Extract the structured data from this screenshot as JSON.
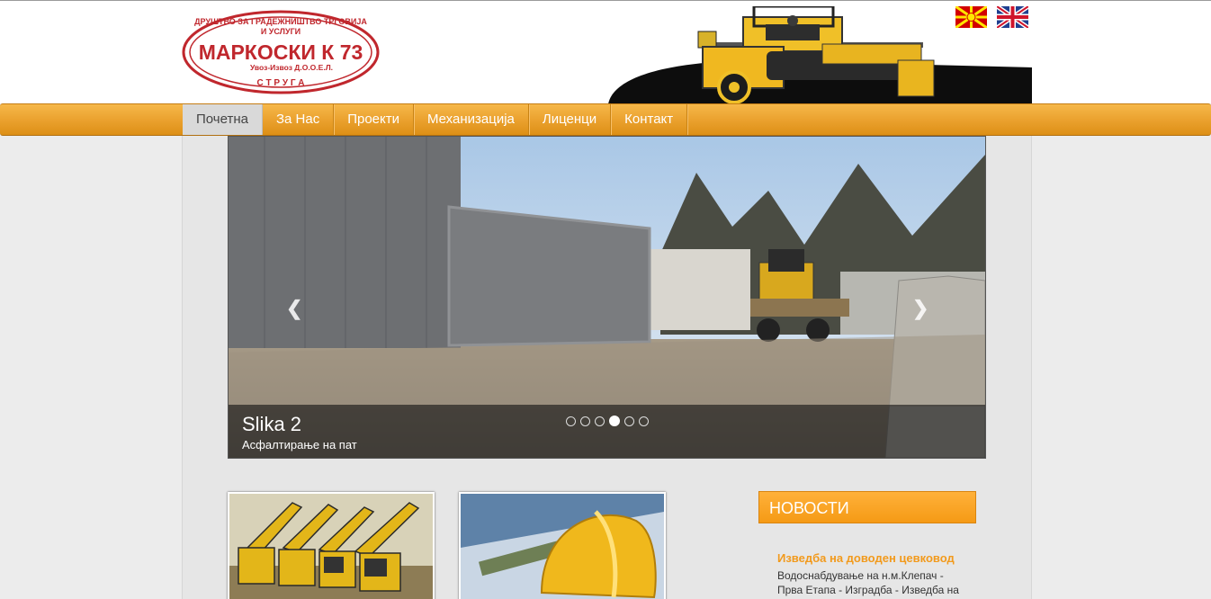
{
  "logo": {
    "top_text": "ДРУШТВО ЗА ГРАДЕЖНИШТВО ТРГОВИЈА",
    "top_text2": "И УСЛУГИ",
    "name": "МАРКОСКИ К 73",
    "subtitle": "Увоз-Извоз Д.О.О.Е.Л.",
    "city": "С Т Р У Г А"
  },
  "languages": [
    {
      "name": "macedonian-flag-icon"
    },
    {
      "name": "uk-flag-icon"
    }
  ],
  "nav": {
    "items": [
      {
        "label": "Почетна",
        "active": true
      },
      {
        "label": "За Нас"
      },
      {
        "label": "Проекти"
      },
      {
        "label": "Механизација"
      },
      {
        "label": "Лиценци"
      },
      {
        "label": "Контакт"
      }
    ]
  },
  "slider": {
    "title": "Slika 2",
    "subtitle": "Асфалтирање на пат",
    "slides_count": 6,
    "active_slide": 4
  },
  "news": {
    "header": "НОВОСТИ",
    "item_title": "Изведба на доводен цевковод",
    "item_text": "Водоснабдување на н.м.Клепач - Прва Етапа - Изградба - Изведба на доводен цевковод и разводна мрежа"
  },
  "colors": {
    "accent": "#eba22f",
    "logo_red": "#c0272d",
    "news_title": "#f29a1c"
  }
}
